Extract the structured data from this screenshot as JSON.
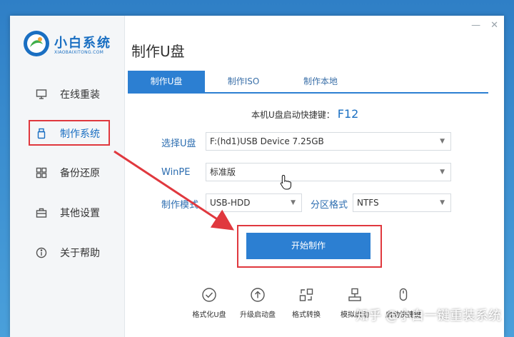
{
  "app": {
    "name": "小白系统",
    "subname": "XIAOBAIXITONG.COM",
    "page_title": "制作U盘",
    "window_controls": [
      "—",
      "✕"
    ]
  },
  "sidebar": {
    "items": [
      {
        "label": "在线重装",
        "icon": "monitor-icon"
      },
      {
        "label": "制作系统",
        "icon": "usb-drive-icon"
      },
      {
        "label": "备份还原",
        "icon": "grid-icon"
      },
      {
        "label": "其他设置",
        "icon": "briefcase-icon"
      },
      {
        "label": "关于帮助",
        "icon": "info-icon"
      }
    ]
  },
  "tabs": [
    {
      "label": "制作U盘"
    },
    {
      "label": "制作ISO"
    },
    {
      "label": "制作本地"
    }
  ],
  "hotkey": {
    "label": "本机U盘启动快捷键：",
    "key": "F12"
  },
  "form": {
    "usb_label": "选择U盘",
    "usb_value": "F:(hd1)USB Device 7.25GB",
    "winpe_label": "WinPE",
    "winpe_value": "标准版",
    "mode_label": "制作模式",
    "mode_value": "USB-HDD",
    "partition_label": "分区格式",
    "partition_value": "NTFS"
  },
  "start_button": "开始制作",
  "tools": [
    {
      "label": "格式化U盘",
      "icon": "check-circle-icon"
    },
    {
      "label": "升级启动盘",
      "icon": "upload-circle-icon"
    },
    {
      "label": "格式转换",
      "icon": "convert-icon"
    },
    {
      "label": "模拟启动",
      "icon": "pc-stand-icon"
    },
    {
      "label": "启动快捷键",
      "icon": "mouse-icon"
    }
  ],
  "watermark": "知乎 @小白一键重装系统",
  "colors": {
    "accent": "#2c7fd2",
    "highlight": "#e0383e"
  }
}
